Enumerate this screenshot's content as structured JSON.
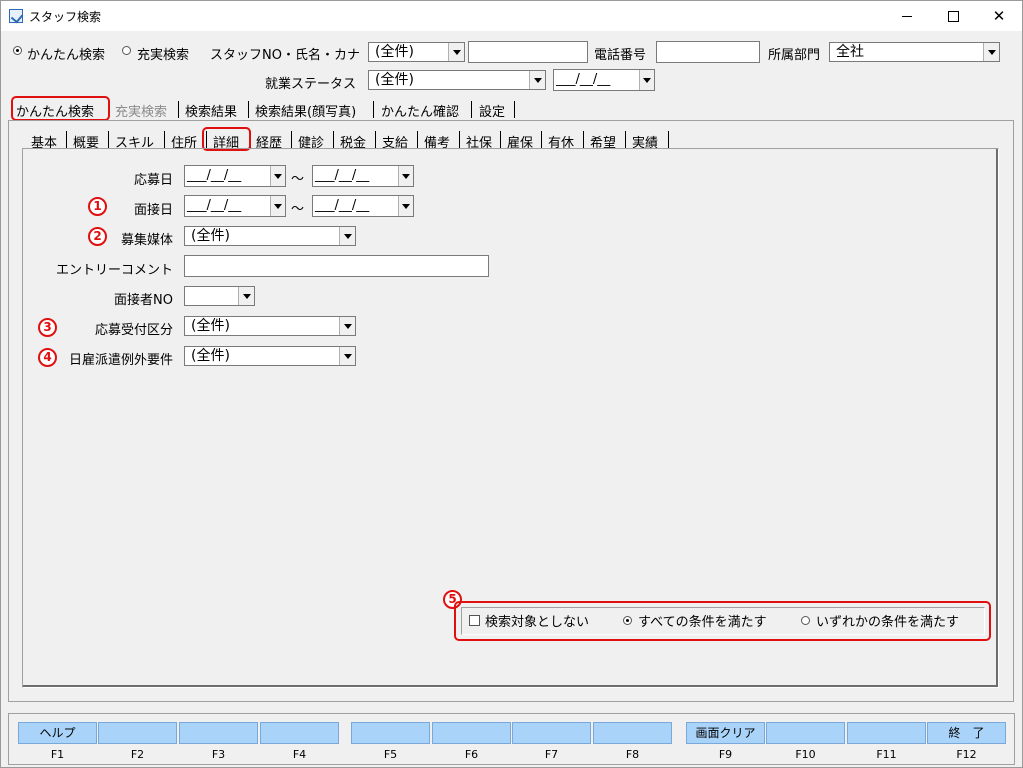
{
  "window": {
    "title": "スタッフ検索",
    "min": "—",
    "max": "☐",
    "close": "✕"
  },
  "header": {
    "mode_easy": "かんたん検索",
    "mode_full": "充実検索",
    "staff_label": "スタッフNO・氏名・カナ",
    "staff_combo": "(全件)",
    "staff_input": "",
    "phone_label": "電話番号",
    "phone_input": "",
    "dept_label": "所属部門",
    "dept_value": "全社",
    "status_label": "就業ステータス",
    "status_value": "(全件)",
    "status_date": "___/__/__"
  },
  "main_tabs": [
    "かんたん検索",
    "充実検索",
    "検索結果",
    "検索結果(顔写真)",
    "かんたん確認",
    "設定"
  ],
  "sub_tabs": [
    "基本",
    "概要",
    "スキル",
    "住所",
    "詳細",
    "経歴",
    "健診",
    "税金",
    "支給",
    "備考",
    "社保",
    "雇保",
    "有休",
    "希望",
    "実績"
  ],
  "form": {
    "apply_date_label": "応募日",
    "interview_date_label": "面接日",
    "date_placeholder": "___/__/__",
    "tilde": "～",
    "media_label": "募集媒体",
    "media_value": "(全件)",
    "entry_comment_label": "エントリーコメント",
    "entry_comment_value": "",
    "interviewer_label": "面接者NO",
    "interviewer_value": "",
    "apply_class_label": "応募受付区分",
    "apply_class_value": "(全件)",
    "dispatch_label": "日雇派遣例外要件",
    "dispatch_value": "(全件)"
  },
  "annotations": {
    "n1": "1",
    "n2": "2",
    "n3": "3",
    "n4": "4",
    "n5": "5"
  },
  "conditions": {
    "exclude": "検索対象としない",
    "all": "すべての条件を満たす",
    "any": "いずれかの条件を満たす"
  },
  "fkeys": [
    {
      "label": "ヘルプ",
      "key": "F1"
    },
    {
      "label": "",
      "key": "F2"
    },
    {
      "label": "",
      "key": "F3"
    },
    {
      "label": "",
      "key": "F4"
    },
    {
      "label": "",
      "key": "F5"
    },
    {
      "label": "",
      "key": "F6"
    },
    {
      "label": "",
      "key": "F7"
    },
    {
      "label": "",
      "key": "F8"
    },
    {
      "label": "画面クリア",
      "key": "F9"
    },
    {
      "label": "",
      "key": "F10"
    },
    {
      "label": "",
      "key": "F11"
    },
    {
      "label": "終　了",
      "key": "F12"
    }
  ],
  "colors": {
    "accent_red": "#e01010",
    "fkey_bg": "#a9d3f8"
  }
}
